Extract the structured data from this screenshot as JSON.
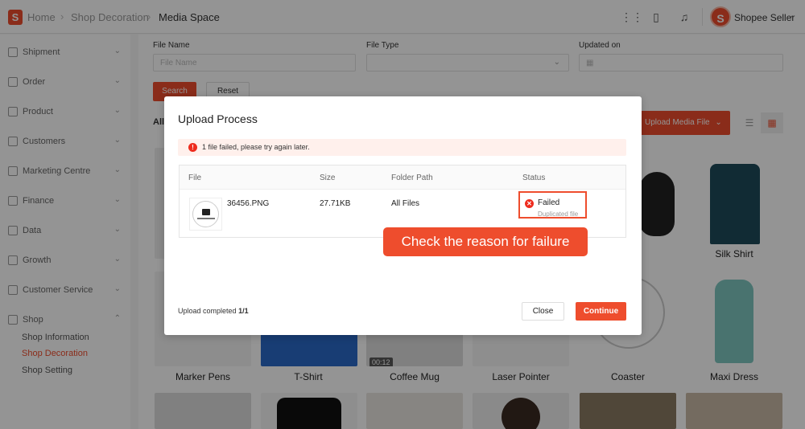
{
  "header": {
    "breadcrumb": [
      "Home",
      "Shop Decoration",
      "Media Space"
    ],
    "seller_name": "Shopee Seller"
  },
  "sidebar": {
    "items": [
      {
        "label": "Shipment"
      },
      {
        "label": "Order"
      },
      {
        "label": "Product"
      },
      {
        "label": "Customers"
      },
      {
        "label": "Marketing Centre"
      },
      {
        "label": "Finance"
      },
      {
        "label": "Data"
      },
      {
        "label": "Growth"
      },
      {
        "label": "Customer Service"
      },
      {
        "label": "Shop"
      }
    ],
    "subitems": [
      "Shop Information",
      "Shop Decoration",
      "Shop Setting"
    ]
  },
  "filters": {
    "file_name_label": "File Name",
    "file_name_placeholder": "File Name",
    "file_type_label": "File Type",
    "updated_on_label": "Updated on",
    "search_label": "Search",
    "reset_label": "Reset"
  },
  "main": {
    "all_label": "All",
    "upload_label": "Upload Media File",
    "video_duration": "00:12",
    "card_labels": [
      "Silk Shirt",
      "Marker Pens",
      "T-Shirt",
      "Coffee Mug",
      "Laser Pointer",
      "Coaster",
      "Maxi Dress"
    ]
  },
  "modal": {
    "title": "Upload Process",
    "alert": "1 file failed, please try again later.",
    "columns": [
      "File",
      "Size",
      "Folder Path",
      "Status"
    ],
    "row": {
      "file": "36456.PNG",
      "size": "27.71KB",
      "folder": "All Files",
      "status": "Failed",
      "reason": "Duplicated file"
    },
    "completed_label": "Upload completed",
    "completed_count": "1/1",
    "close_label": "Close",
    "continue_label": "Continue"
  },
  "callout": "Check the reason for failure",
  "colors": {
    "accent": "#ee4d2d",
    "error": "#ee2c1e"
  }
}
